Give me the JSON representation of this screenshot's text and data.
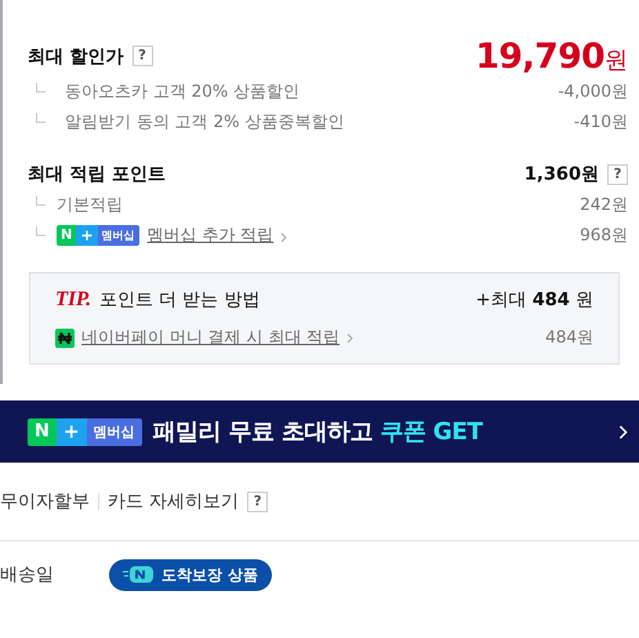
{
  "discount": {
    "label": "최대 할인가",
    "help": "?",
    "price": "19,790",
    "unit": "원",
    "items": [
      {
        "label": "동아오츠카 고객 20% 상품할인",
        "amount": "-4,000원"
      },
      {
        "label": "알림받기 동의 고객 2% 상품중복할인",
        "amount": "-410원"
      }
    ]
  },
  "points": {
    "label": "최대 적립 포인트",
    "total": "1,360원",
    "help": "?",
    "items": [
      {
        "kind": "plain",
        "label": "기본적립",
        "amount": "242원"
      },
      {
        "kind": "membership",
        "badge": [
          "N",
          "+",
          "멤버십"
        ],
        "label": "멤버십 추가 적립",
        "amount": "968원"
      }
    ]
  },
  "tip": {
    "mark": "TIP.",
    "title": "포인트 더 받는 방법",
    "bonus_prefix": "+최대",
    "bonus": "484",
    "bonus_unit": "원",
    "link": "네이버페이 머니 결제 시 최대 적립",
    "amount": "484원"
  },
  "banner": {
    "badge": [
      "N",
      "+",
      "멤버십"
    ],
    "text": "패밀리 무료 초대하고",
    "highlight": "쿠폰 GET"
  },
  "installment": {
    "label": "무이자할부",
    "link": "카드 자세히보기",
    "help": "?"
  },
  "delivery": {
    "label": "배송일",
    "badge": "도착보장 상품"
  }
}
